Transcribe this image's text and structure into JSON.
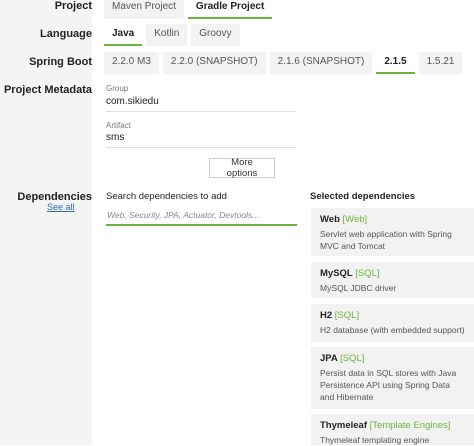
{
  "project": {
    "label": "Project",
    "options": [
      {
        "label": "Maven Project",
        "selected": false
      },
      {
        "label": "Gradle Project",
        "selected": true
      }
    ]
  },
  "language": {
    "label": "Language",
    "options": [
      {
        "label": "Java",
        "selected": true
      },
      {
        "label": "Kotlin",
        "selected": false
      },
      {
        "label": "Groovy",
        "selected": false
      }
    ]
  },
  "spring_boot": {
    "label": "Spring Boot",
    "options": [
      {
        "label": "2.2.0 M3",
        "selected": false
      },
      {
        "label": "2.2.0 (SNAPSHOT)",
        "selected": false
      },
      {
        "label": "2.1.6 (SNAPSHOT)",
        "selected": false
      },
      {
        "label": "2.1.5",
        "selected": true
      },
      {
        "label": "1.5.21",
        "selected": false
      }
    ]
  },
  "metadata": {
    "label": "Project Metadata",
    "group_label": "Group",
    "group_value": "com.sikiedu",
    "artifact_label": "Artifact",
    "artifact_value": "sms",
    "more_options": "More options"
  },
  "dependencies": {
    "label": "Dependencies",
    "see_all": "See all",
    "search_title": "Search dependencies to add",
    "search_placeholder": "Web, Security, JPA, Actuator, Devtools...",
    "selected_title": "Selected dependencies",
    "selected": [
      {
        "name": "Web",
        "tag": "[Web]",
        "description": "Servlet web application with Spring MVC and Tomcat"
      },
      {
        "name": "MySQL",
        "tag": "[SQL]",
        "description": "MySQL JDBC driver"
      },
      {
        "name": "H2",
        "tag": "[SQL]",
        "description": "H2 database (with embedded support)"
      },
      {
        "name": "JPA",
        "tag": "[SQL]",
        "description": "Persist data in SQL stores with Java Persistence API using Spring Data and Hibernate"
      },
      {
        "name": "Thymeleaf",
        "tag": "[Template Engines]",
        "description": "Thymeleaf templating engine"
      }
    ]
  },
  "colors": {
    "accent": "#6db33f",
    "link": "#2a6db0",
    "sidebar_bg": "#f4f4f4",
    "card_bg": "#f2f2f2"
  }
}
